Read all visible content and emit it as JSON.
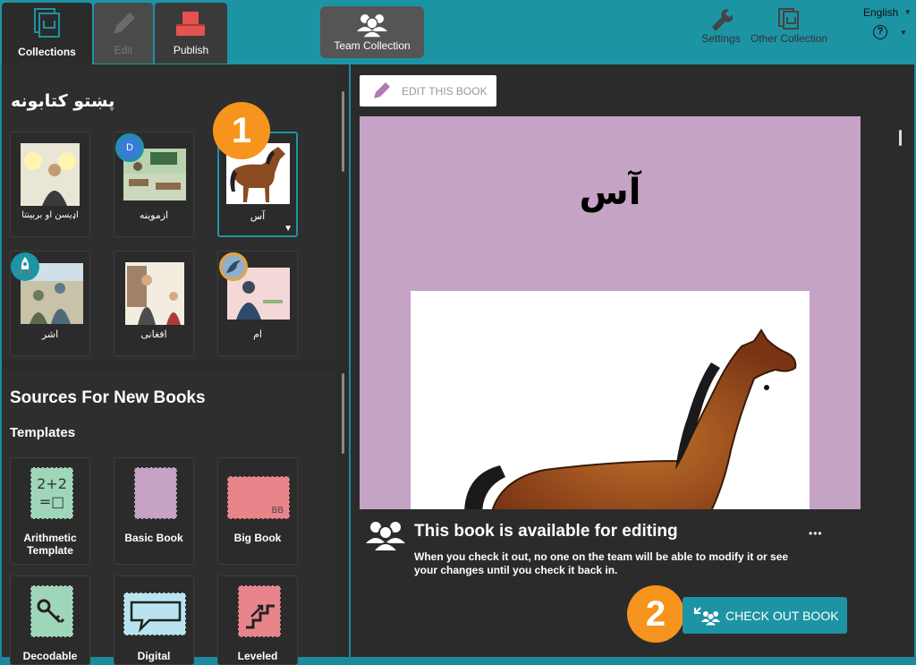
{
  "topbar": {
    "tabs": [
      {
        "label": "Collections",
        "state": "active"
      },
      {
        "label": "Edit",
        "state": "disabled"
      },
      {
        "label": "Publish",
        "state": "normal"
      }
    ],
    "team_collection_label": "Team Collection",
    "settings_label": "Settings",
    "other_collection_label": "Other Collection",
    "language": "English",
    "help_glyph": "?"
  },
  "collection": {
    "title": "پښتو کتابونه",
    "books": [
      {
        "title": "اډیسن او بربینتا",
        "badge": null
      },
      {
        "title": "ازموینه",
        "badge": "D"
      },
      {
        "title": "آس",
        "badge": null,
        "selected": true
      },
      {
        "title": "اشر",
        "badge": "rocket"
      },
      {
        "title": "افغانی",
        "badge": null
      },
      {
        "title": "ام",
        "badge": "bird"
      }
    ]
  },
  "sources": {
    "title": "Sources For New Books",
    "templates_heading": "Templates",
    "templates": [
      {
        "label": "Arithmetic Template",
        "glyph": "2+2\n=□"
      },
      {
        "label": "Basic Book"
      },
      {
        "label": "Big Book",
        "corner": "BB"
      },
      {
        "label": "Decodable"
      },
      {
        "label": "Digital"
      },
      {
        "label": "Leveled"
      }
    ]
  },
  "editor": {
    "edit_button_label": "EDIT THIS BOOK",
    "page_title": "آس"
  },
  "checkout_panel": {
    "heading": "This book is available for editing",
    "body": "When you check it out, no one on the team will be able to modify it or see your changes until you check it back in.",
    "more_glyph": "•••",
    "button_label": "CHECK OUT BOOK"
  },
  "callouts": {
    "one": "1",
    "two": "2"
  },
  "colors": {
    "accent": "#1d94a4",
    "callout": "#f7941d",
    "page_bg": "#c4a3c4"
  }
}
